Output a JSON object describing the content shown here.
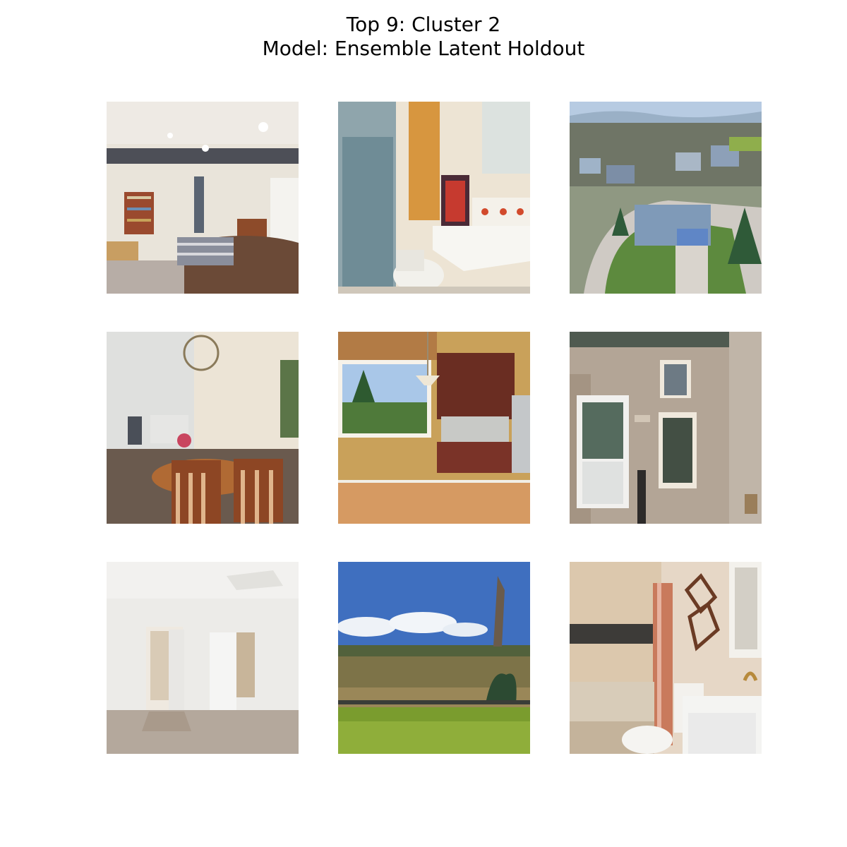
{
  "figure": {
    "title_line1": "Top 9: Cluster 2",
    "title_line2": "Model: Ensemble Latent Holdout"
  },
  "grid": {
    "rows": 3,
    "cols": 3,
    "tiles": [
      {
        "scene": "basement family room with bookshelves and leather sofa"
      },
      {
        "scene": "bathroom with frosted glass shower, toilet and pedestal sink"
      },
      {
        "scene": "aerial view of suburban house on corner lot"
      },
      {
        "scene": "dining room with wooden table, chairs and chandelier"
      },
      {
        "scene": "kitchen nook with large window, hardwood floor and cherry cabinets"
      },
      {
        "scene": "brick exterior with white front door and windows"
      },
      {
        "scene": "empty carpeted bedroom with open closet doors"
      },
      {
        "scene": "backyard lawn with fence, open field and blue sky"
      },
      {
        "scene": "bathroom with tiled tub surround, shower curtain and vanity"
      }
    ]
  }
}
